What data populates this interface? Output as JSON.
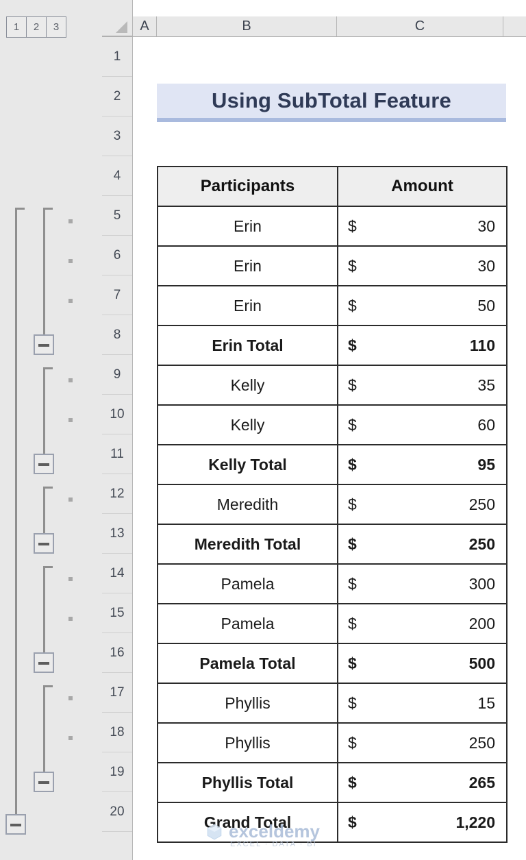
{
  "outline": {
    "level_buttons": [
      {
        "label": "1"
      },
      {
        "label": "2"
      },
      {
        "label": "3"
      }
    ]
  },
  "columns": [
    {
      "label": "A"
    },
    {
      "label": "B"
    },
    {
      "label": "C"
    }
  ],
  "rows": [
    {
      "number": "1"
    },
    {
      "number": "2"
    },
    {
      "number": "3"
    },
    {
      "number": "4"
    },
    {
      "number": "5"
    },
    {
      "number": "6"
    },
    {
      "number": "7"
    },
    {
      "number": "8"
    },
    {
      "number": "9"
    },
    {
      "number": "10"
    },
    {
      "number": "11"
    },
    {
      "number": "12"
    },
    {
      "number": "13"
    },
    {
      "number": "14"
    },
    {
      "number": "15"
    },
    {
      "number": "16"
    },
    {
      "number": "17"
    },
    {
      "number": "18"
    },
    {
      "number": "19"
    },
    {
      "number": "20"
    }
  ],
  "title": {
    "text": "Using SubTotal Feature",
    "background": "#e0e5f4",
    "accent": "#a9bade"
  },
  "table": {
    "headers": [
      {
        "label": "Participants"
      },
      {
        "label": "Amount"
      }
    ],
    "currency_symbol": "$",
    "rows": [
      {
        "participant": "Erin",
        "amount": "30",
        "is_total": false,
        "row": "5"
      },
      {
        "participant": "Erin",
        "amount": "30",
        "is_total": false,
        "row": "6"
      },
      {
        "participant": "Erin",
        "amount": "50",
        "is_total": false,
        "row": "7"
      },
      {
        "participant": "Erin Total",
        "amount": "110",
        "is_total": true,
        "row": "8"
      },
      {
        "participant": "Kelly",
        "amount": "35",
        "is_total": false,
        "row": "9"
      },
      {
        "participant": "Kelly",
        "amount": "60",
        "is_total": false,
        "row": "10"
      },
      {
        "participant": "Kelly Total",
        "amount": "95",
        "is_total": true,
        "row": "11"
      },
      {
        "participant": "Meredith",
        "amount": "250",
        "is_total": false,
        "row": "12"
      },
      {
        "participant": "Meredith Total",
        "amount": "250",
        "is_total": true,
        "row": "13"
      },
      {
        "participant": "Pamela",
        "amount": "300",
        "is_total": false,
        "row": "14"
      },
      {
        "participant": "Pamela",
        "amount": "200",
        "is_total": false,
        "row": "15"
      },
      {
        "participant": "Pamela Total",
        "amount": "500",
        "is_total": true,
        "row": "16"
      },
      {
        "participant": "Phyllis",
        "amount": "15",
        "is_total": false,
        "row": "17"
      },
      {
        "participant": "Phyllis",
        "amount": "250",
        "is_total": false,
        "row": "18"
      },
      {
        "participant": "Phyllis Total",
        "amount": "265",
        "is_total": true,
        "row": "19"
      },
      {
        "participant": "Grand Total",
        "amount": "1,220",
        "is_total": true,
        "row": "20"
      }
    ]
  },
  "watermark": {
    "word": "exceldemy",
    "tagline": "EXCEL · DATA · BI"
  }
}
